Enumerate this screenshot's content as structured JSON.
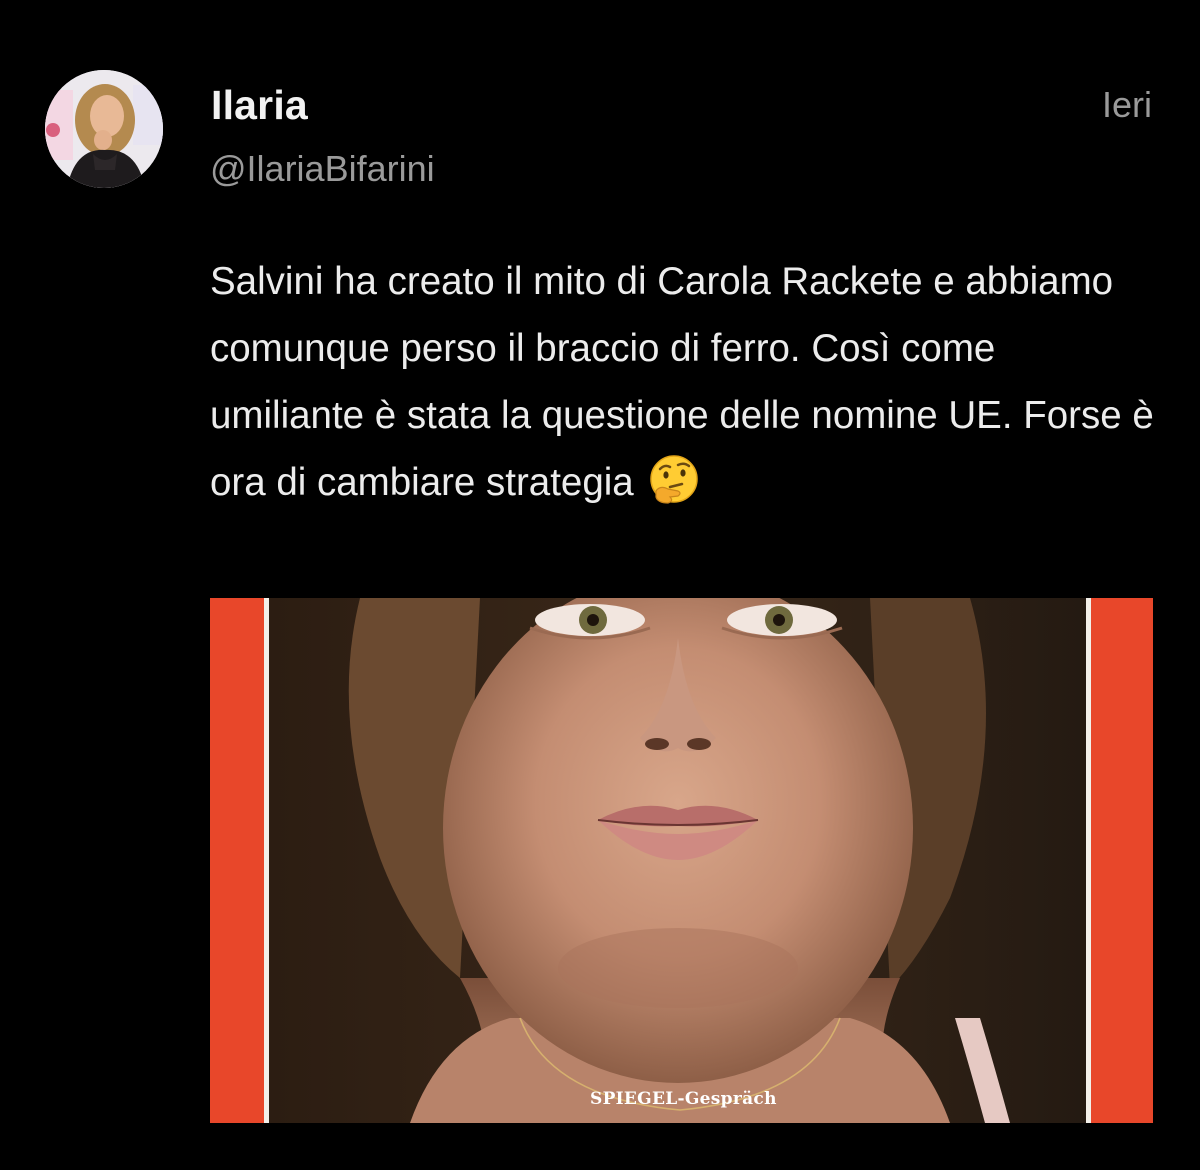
{
  "author": {
    "name": "Ilaria",
    "handle": "@IlariaBifarini",
    "avatar_icon": "profile-avatar"
  },
  "timestamp": "Ieri",
  "tweet": {
    "text": "Salvini ha creato il mito di Carola Rackete e abbiamo comunque perso il braccio di ferro. Così come umiliante è stata la questione delle nomine UE. Forse è ora di cambiare strategia",
    "emoji": "thinking-face-emoji"
  },
  "media": {
    "caption": "SPIEGEL-Gespräch",
    "frame_color": "#e8472a"
  },
  "colors": {
    "background": "#000000",
    "primary_text": "#ececec",
    "secondary_text": "#9a9a9a"
  }
}
